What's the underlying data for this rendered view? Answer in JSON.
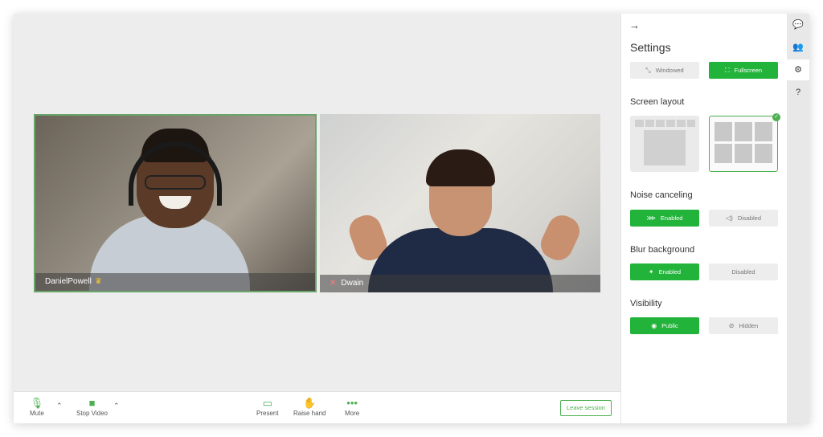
{
  "participants": [
    {
      "name": "DanielPowell",
      "badge_icon": "crown-icon",
      "active_speaker": true
    },
    {
      "name": "Dwain",
      "muted": true
    }
  ],
  "toolbar": {
    "mute_label": "Mute",
    "stop_video_label": "Stop Video",
    "present_label": "Present",
    "raise_hand_label": "Raise hand",
    "more_label": "More",
    "leave_label": "Leave session"
  },
  "settings": {
    "title": "Settings",
    "window_mode": {
      "windowed": "Windowed",
      "fullscreen": "Fullscreen",
      "selected": "fullscreen"
    },
    "screen_layout": {
      "label": "Screen layout",
      "selected": "grid"
    },
    "noise_canceling": {
      "label": "Noise canceling",
      "enabled": "Enabled",
      "disabled": "Disabled",
      "selected": "enabled"
    },
    "blur_background": {
      "label": "Blur background",
      "enabled": "Enabled",
      "disabled": "Disabled",
      "selected": "enabled"
    },
    "visibility": {
      "label": "Visibility",
      "public": "Public",
      "hidden": "Hidden",
      "selected": "public"
    }
  },
  "rail": [
    "chat-icon",
    "participants-icon",
    "settings-icon",
    "help-icon"
  ],
  "colors": {
    "accent": "#22b33a",
    "active_border": "#6aa56a"
  }
}
